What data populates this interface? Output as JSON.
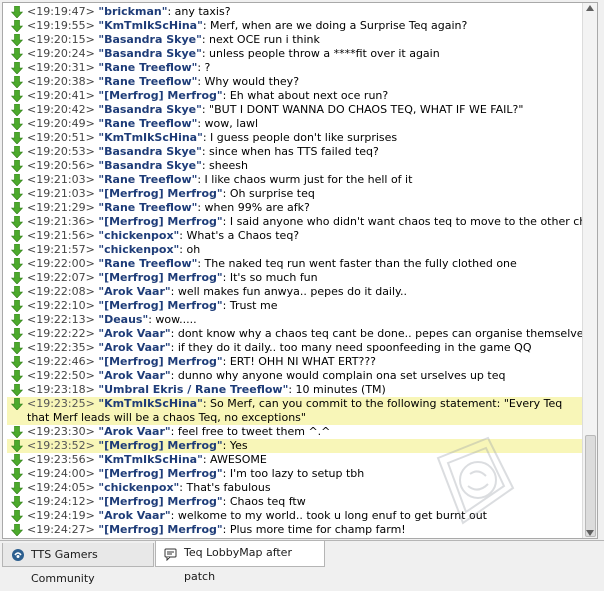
{
  "chat": {
    "lines": [
      {
        "ts": "<19:19:47>",
        "nick": "\"brickman\"",
        "msg": ": any taxis?"
      },
      {
        "ts": "<19:19:55>",
        "nick": "\"KmTmIkScHina\"",
        "msg": ": Merf, when are we doing a Surprise Teq again?"
      },
      {
        "ts": "<19:20:15>",
        "nick": "\"Basandra Skye\"",
        "msg": ": next OCE run i think"
      },
      {
        "ts": "<19:20:24>",
        "nick": "\"Basandra Skye\"",
        "msg": ": unless people throw a ****fit over it again"
      },
      {
        "ts": "<19:20:31>",
        "nick": "\"Rane Treeflow\"",
        "msg": ": ?"
      },
      {
        "ts": "<19:20:38>",
        "nick": "\"Rane Treeflow\"",
        "msg": ": Why would they?"
      },
      {
        "ts": "<19:20:41>",
        "nick": "\"[Merfrog] Merfrog\"",
        "msg": ": Eh what about next oce run?"
      },
      {
        "ts": "<19:20:42>",
        "nick": "\"Basandra Skye\"",
        "msg": ": \"BUT I DONT WANNA DO CHAOS TEQ, WHAT IF WE FAIL?\""
      },
      {
        "ts": "<19:20:49>",
        "nick": "\"Rane Treeflow\"",
        "msg": ": wow, lawl"
      },
      {
        "ts": "<19:20:51>",
        "nick": "\"KmTmIkScHina\"",
        "msg": ": I guess people don't like surprises"
      },
      {
        "ts": "<19:20:53>",
        "nick": "\"Basandra Skye\"",
        "msg": ": since when has TTS failed teq?"
      },
      {
        "ts": "<19:20:56>",
        "nick": "\"Basandra Skye\"",
        "msg": ": sheesh"
      },
      {
        "ts": "<19:21:03>",
        "nick": "\"Rane Treeflow\"",
        "msg": ": I like chaos wurm just for the hell of it"
      },
      {
        "ts": "<19:21:03>",
        "nick": "\"[Merfrog] Merfrog\"",
        "msg": ": Oh surprise teq"
      },
      {
        "ts": "<19:21:29>",
        "nick": "\"Rane Treeflow\"",
        "msg": ": when 99% are afk?"
      },
      {
        "ts": "<19:21:36>",
        "nick": "\"[Merfrog] Merfrog\"",
        "msg": ": I said anyone who didn't want chaos teq to move to the other channel"
      },
      {
        "ts": "<19:21:56>",
        "nick": "\"chickenpox\"",
        "msg": ": What's a Chaos teq?"
      },
      {
        "ts": "<19:21:57>",
        "nick": "\"chickenpox\"",
        "msg": ": oh"
      },
      {
        "ts": "<19:22:00>",
        "nick": "\"Rane Treeflow\"",
        "msg": ": The naked teq run went faster than the fully clothed one"
      },
      {
        "ts": "<19:22:07>",
        "nick": "\"[Merfrog] Merfrog\"",
        "msg": ": It's so much fun"
      },
      {
        "ts": "<19:22:08>",
        "nick": "\"Arok Vaar\"",
        "msg": ": well makes fun anwya.. pepes do it daily.."
      },
      {
        "ts": "<19:22:10>",
        "nick": "\"[Merfrog] Merfrog\"",
        "msg": ": Trust me"
      },
      {
        "ts": "<19:22:13>",
        "nick": "\"Deaus\"",
        "msg": ": wow....."
      },
      {
        "ts": "<19:22:22>",
        "nick": "\"Arok Vaar\"",
        "msg": ": dont know why a chaos teq cant be done.. pepes can organise themselves"
      },
      {
        "ts": "<19:22:35>",
        "nick": "\"Arok Vaar\"",
        "msg": ": if they do it daily.. too many need spoonfeeding in the game QQ"
      },
      {
        "ts": "<19:22:46>",
        "nick": "\"[Merfrog] Merfrog\"",
        "msg": ": ERT! OHH NI WHAT ERT???"
      },
      {
        "ts": "<19:22:50>",
        "nick": "\"Arok Vaar\"",
        "msg": ": dunno why anyone would complain ona  set urselves up teq"
      },
      {
        "ts": "<19:23:18>",
        "nick": "\"Umbral Ekris / Rane Treeflow\"",
        "msg": ": 10 minutes (TM)"
      },
      {
        "ts": "<19:23:25>",
        "nick": "\"KmTmIkScHina\"",
        "msg": ": So Merf, can you commit to the following statement: \"Every Teq that Merf leads will be a chaos Teq, no exceptions\"",
        "highlight": true,
        "wrap": true
      },
      {
        "ts": "<19:23:30>",
        "nick": "\"Arok Vaar\"",
        "msg": ": feel free to tweet them ^.^"
      },
      {
        "ts": "<19:23:52>",
        "nick": "\"[Merfrog] Merfrog\"",
        "msg": ": Yes",
        "highlight": true
      },
      {
        "ts": "<19:23:56>",
        "nick": "\"KmTmIkScHina\"",
        "msg": ": AWESOME"
      },
      {
        "ts": "<19:24:00>",
        "nick": "\"[Merfrog] Merfrog\"",
        "msg": ": I'm too lazy to setup tbh"
      },
      {
        "ts": "<19:24:05>",
        "nick": "\"chickenpox\"",
        "msg": ": That's fabulous"
      },
      {
        "ts": "<19:24:12>",
        "nick": "\"[Merfrog] Merfrog\"",
        "msg": ": Chaos teq ftw"
      },
      {
        "ts": "<19:24:19>",
        "nick": "\"Arok Vaar\"",
        "msg": ": welkome to my world.. took u long enuf to get burnt out"
      },
      {
        "ts": "<19:24:27>",
        "nick": "\"[Merfrog] Merfrog\"",
        "msg": ": Plus more time for champ farm!"
      }
    ]
  },
  "tabs": [
    {
      "label": "TTS Gamers Community",
      "icon": "server-icon",
      "active": false
    },
    {
      "label": "Teq LobbyMap after patch",
      "icon": "channel-chat-icon",
      "active": true
    }
  ],
  "colors": {
    "nick": "#1e3c78",
    "arrow": "#4caa2c",
    "highlight": "#f8f6b8"
  }
}
